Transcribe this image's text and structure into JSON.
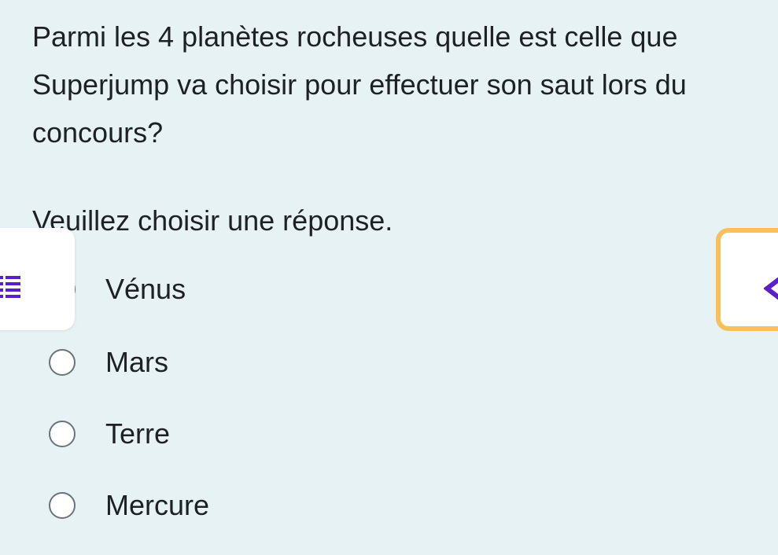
{
  "question": {
    "text": "Parmi les 4 planètes rocheuses quelle est celle que Superjump va choisir pour effectuer son saut lors du concours?",
    "prompt": "Veuillez choisir une réponse."
  },
  "options": [
    {
      "label": "Vénus",
      "selected": false
    },
    {
      "label": "Mars",
      "selected": false
    },
    {
      "label": "Terre",
      "selected": false
    },
    {
      "label": "Mercure",
      "selected": false
    }
  ],
  "drawer_toggle": {
    "icon": "list-icon",
    "color": "#5a1fc8"
  },
  "quiz_navigation": {
    "icon": "chevron-left-icon",
    "color": "#5a1fc8",
    "border_color": "#f8bf5a"
  },
  "colors": {
    "background": "#e7f2f5",
    "text": "#1d2125",
    "accent": "#5a1fc8"
  }
}
